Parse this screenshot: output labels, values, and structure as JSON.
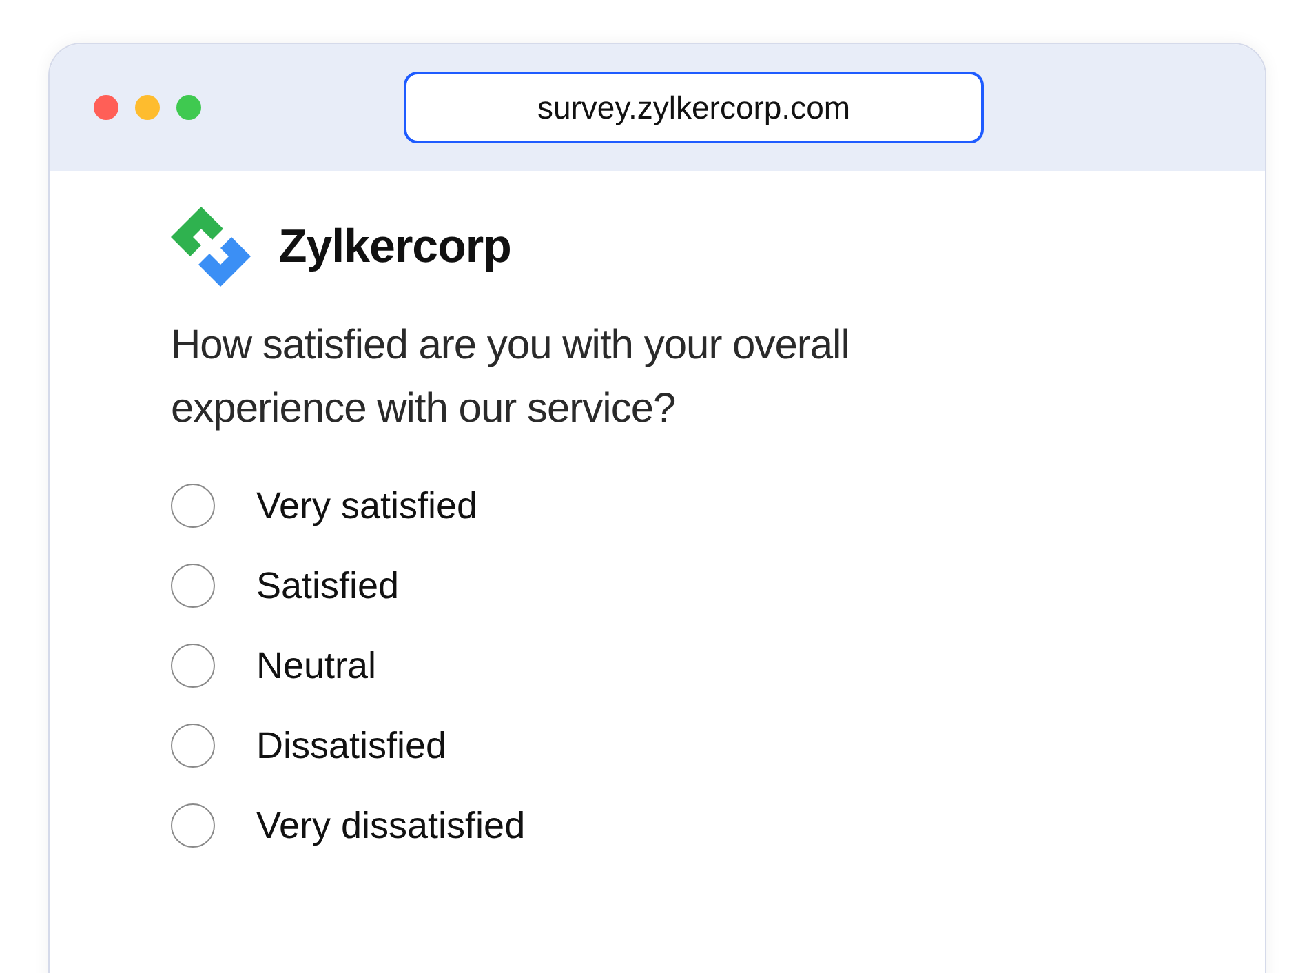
{
  "browser": {
    "url": "survey.zylkercorp.com"
  },
  "brand": {
    "name": "Zylkercorp"
  },
  "question": "How satisfied are you with your overall experience with our service?",
  "options": [
    {
      "label": "Very satisfied",
      "selected": false
    },
    {
      "label": "Satisfied",
      "selected": false
    },
    {
      "label": "Neutral",
      "selected": false
    },
    {
      "label": "Dissatisfied",
      "selected": false
    },
    {
      "label": "Very dissatisfied",
      "selected": false
    }
  ]
}
